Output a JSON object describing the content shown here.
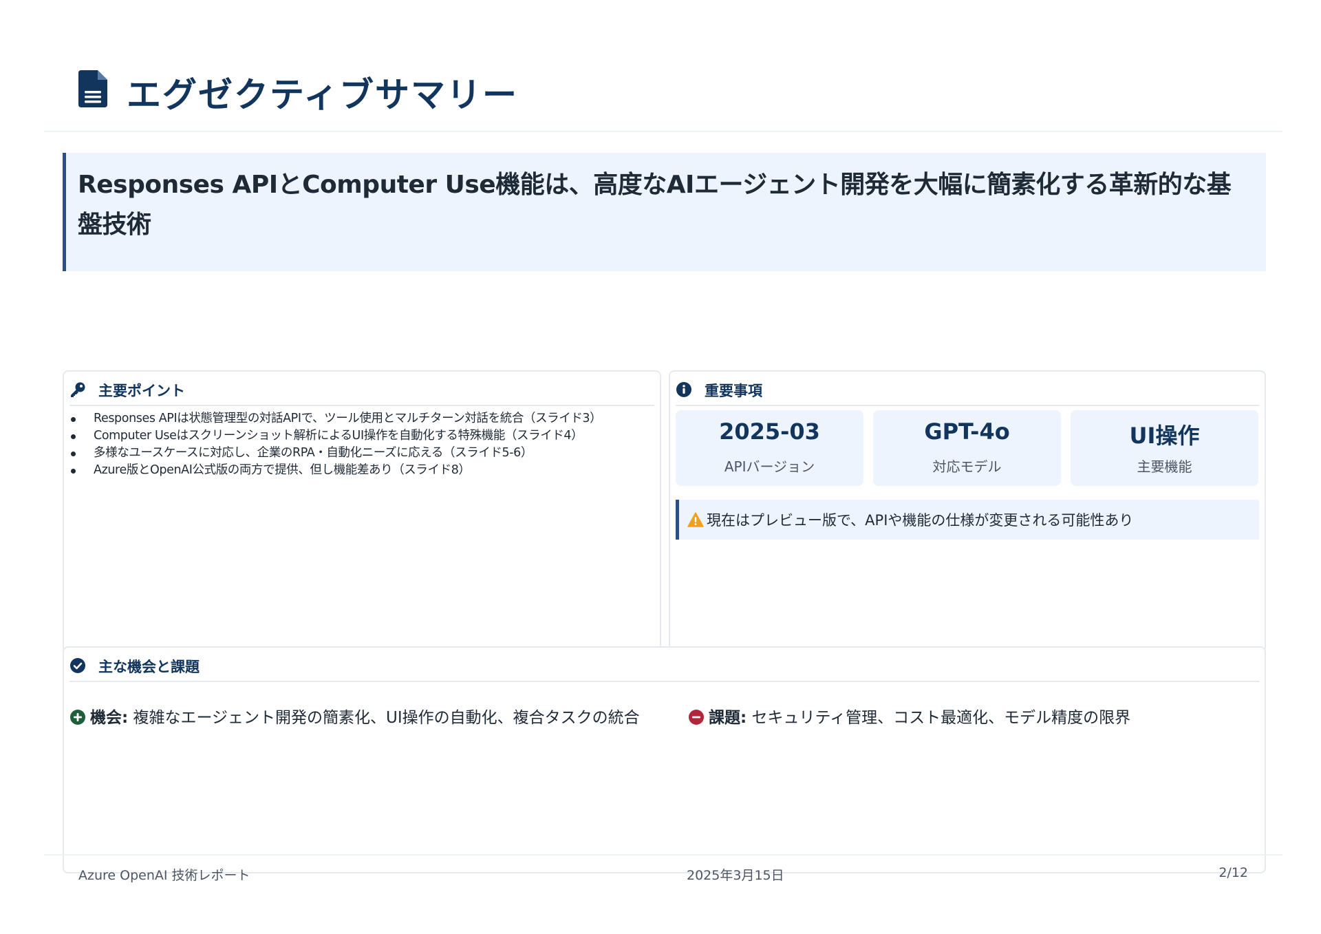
{
  "header": {
    "title": "エグゼクティブサマリー",
    "icon": "document-icon"
  },
  "headline": {
    "text": "Responses APIとComputer Use機能は、高度なAIエージェント開発を大幅に簡素化する革新的な基盤技術"
  },
  "key_points": {
    "title": "主要ポイント",
    "icon": "key-icon",
    "items": [
      "Responses APIは状態管理型の対話APIで、ツール使用とマルチターン対話を統合（スライド3）",
      "Computer Useはスクリーンショット解析によるUI操作を自動化する特殊機能（スライド4）",
      "多様なユースケースに対応し、企業のRPA・自動化ニーズに応える（スライド5-6）",
      "Azure版とOpenAI公式版の両方で提供、但し機能差あり（スライド8）"
    ]
  },
  "important": {
    "title": "重要事項",
    "icon": "info-icon",
    "stats": [
      {
        "value": "2025-03",
        "label": "APIバージョン"
      },
      {
        "value": "GPT-4o",
        "label": "対応モデル"
      },
      {
        "value": "UI操作",
        "label": "主要機能"
      }
    ],
    "warning": "現在はプレビュー版で、APIや機能の仕様が変更される可能性あり",
    "warning_icon": "warning-triangle-icon"
  },
  "opportunities": {
    "title": "主な機会と課題",
    "icon": "check-circle-icon",
    "opportunity_label": "機会:",
    "opportunity_text": " 複雑なエージェント開発の簡素化、UI操作の自動化、複合タスクの統合",
    "challenge_label": "課題:",
    "challenge_text": " セキュリティ管理、コスト最適化、モデル精度の限界"
  },
  "footer": {
    "left": "Azure OpenAI 技術レポート",
    "center": "2025年3月15日",
    "right": "2/12"
  },
  "colors": {
    "navy": "#12355e",
    "banner": "#edf4fd",
    "accent_border": "#2a4f85",
    "green": "#1e5e3a",
    "red": "#b3263a",
    "warning": "#f0a020"
  }
}
